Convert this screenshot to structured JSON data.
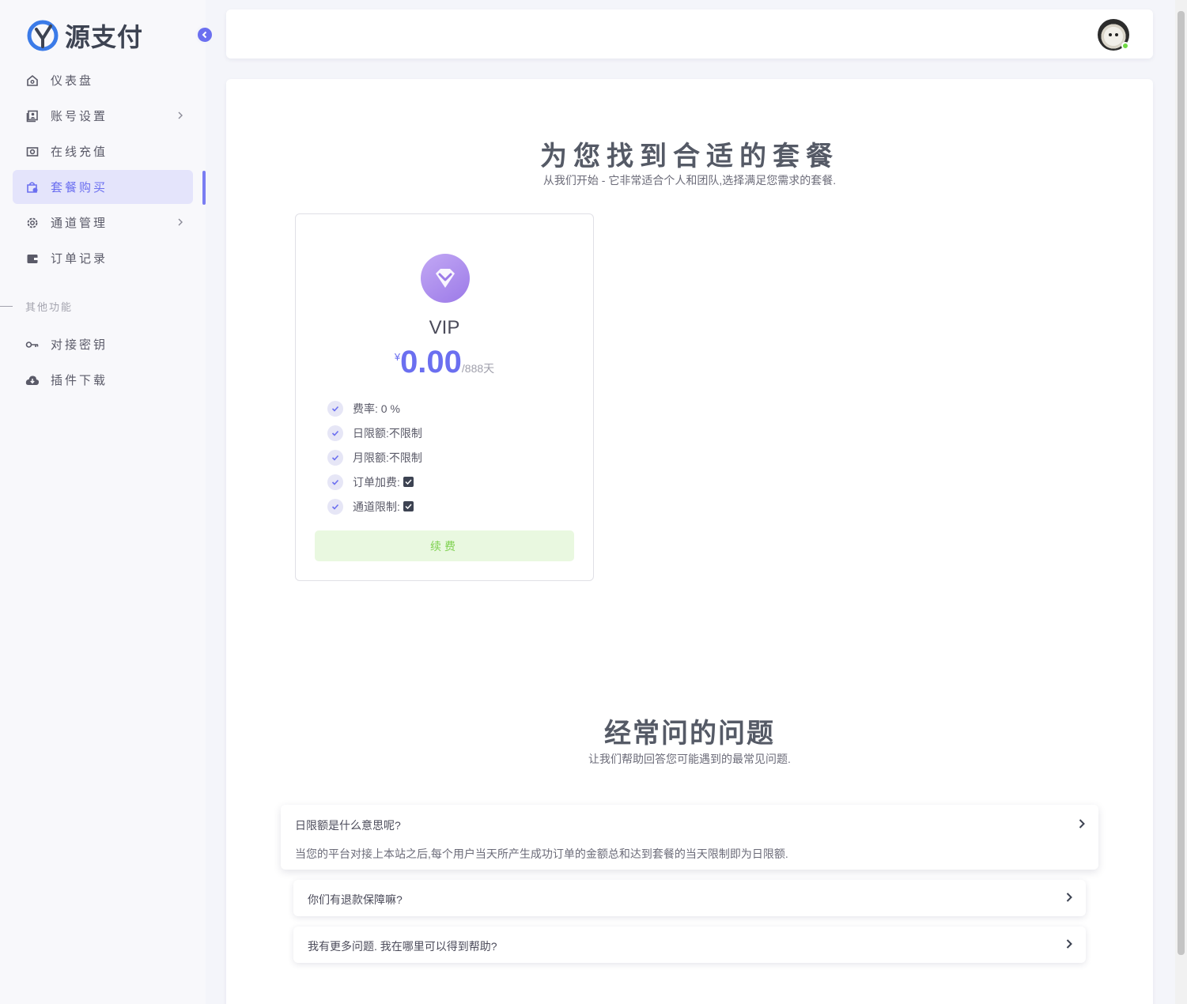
{
  "brand": {
    "name": "源支付"
  },
  "sidebar": {
    "items": [
      {
        "label": "仪表盘",
        "icon": "home-icon"
      },
      {
        "label": "账号设置",
        "icon": "account-icon",
        "has_submenu": true
      },
      {
        "label": "在线充值",
        "icon": "recharge-icon"
      },
      {
        "label": "套餐购买",
        "icon": "shopping-bag-icon",
        "active": true
      },
      {
        "label": "通道管理",
        "icon": "gear-icon",
        "has_submenu": true
      },
      {
        "label": "订单记录",
        "icon": "wallet-icon"
      }
    ],
    "section_label": "其他功能",
    "other_items": [
      {
        "label": "对接密钥",
        "icon": "key-icon"
      },
      {
        "label": "插件下载",
        "icon": "cloud-download-icon"
      }
    ]
  },
  "main": {
    "title": "为您找到合适的套餐",
    "subtitle": "从我们开始 - 它非常适合个人和团队,选择满足您需求的套餐.",
    "plan": {
      "name": "VIP",
      "currency": "¥",
      "price": "0.00",
      "period": "/888天",
      "features": [
        {
          "label": "费率:",
          "value": "0 %"
        },
        {
          "label": "日限额:",
          "value": "不限制"
        },
        {
          "label": "月限额:",
          "value": "不限制"
        },
        {
          "label": "订单加费:",
          "checked": true
        },
        {
          "label": "通道限制:",
          "checked": true
        }
      ],
      "button_label": "续费"
    },
    "faq": {
      "title": "经常问的问题",
      "subtitle": "让我们帮助回答您可能遇到的最常见问题.",
      "items": [
        {
          "question": "日限额是什么意思呢?",
          "answer": "当您的平台对接上本站之后,每个用户当天所产生成功订单的金额总和达到套餐的当天限制即为日限额.",
          "expanded": true
        },
        {
          "question": "你们有退款保障嘛?"
        },
        {
          "question": "我有更多问题. 我在哪里可以得到帮助?"
        }
      ]
    }
  },
  "colors": {
    "accent": "#6b6ff0",
    "success": "#7ed14f",
    "online": "#6fd943"
  }
}
